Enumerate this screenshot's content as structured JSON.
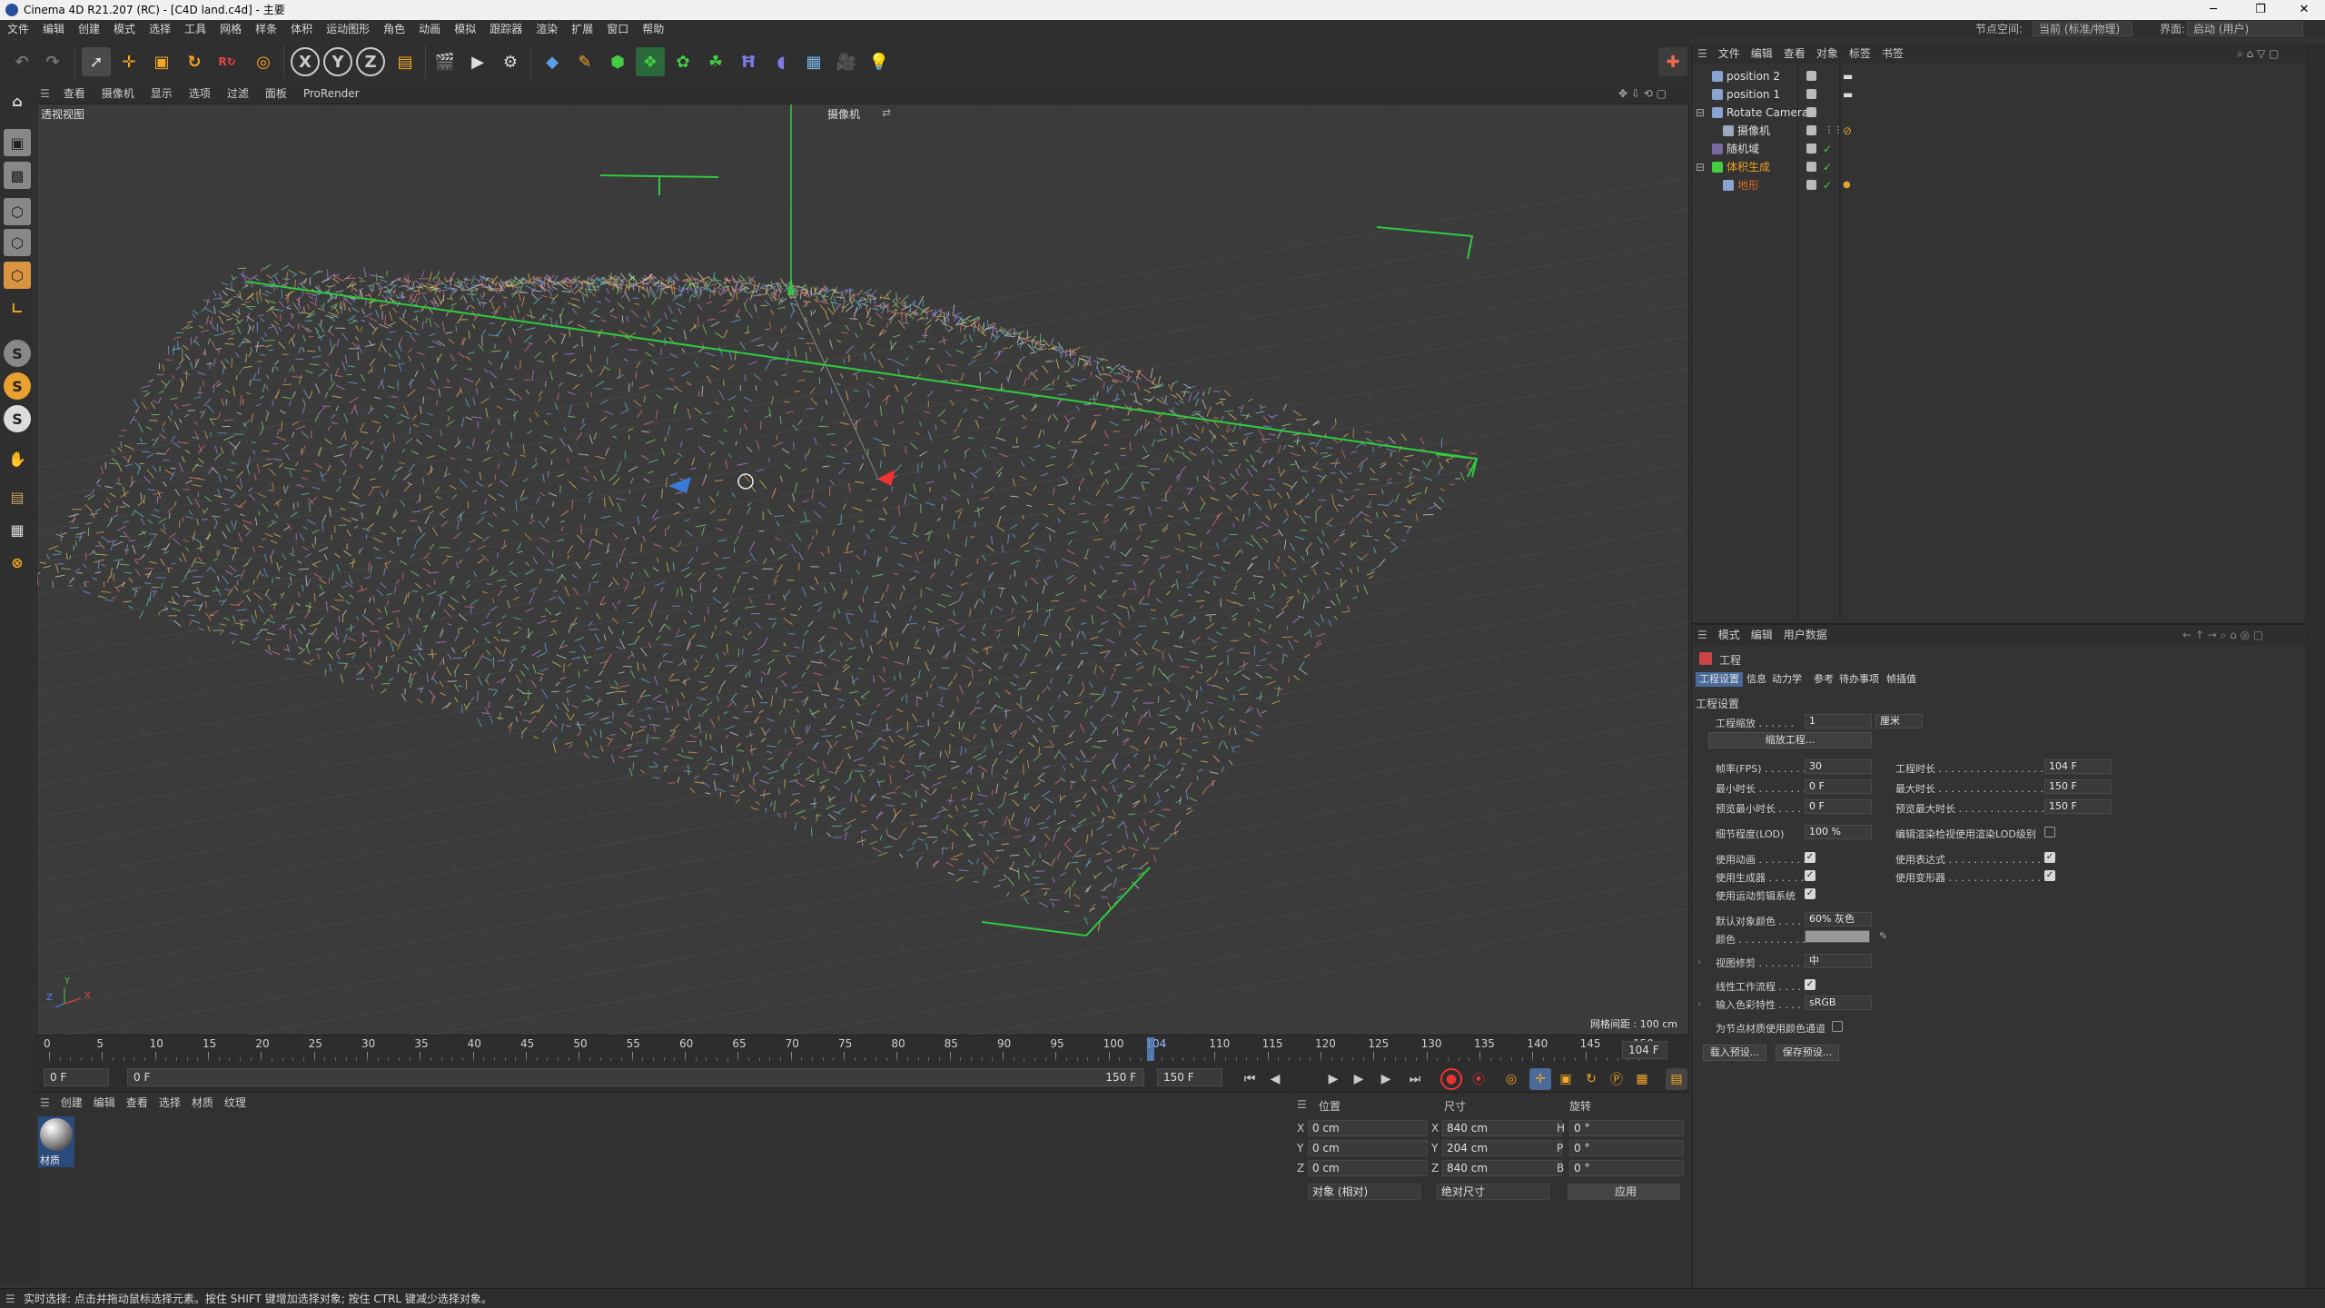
{
  "title": {
    "text": "Cinema 4D R21.207 (RC) - [C4D land.c4d] - 主要",
    "minimize": "─",
    "maximize": "❐",
    "close": "✕"
  },
  "menubar": {
    "items": [
      "文件",
      "编辑",
      "创建",
      "模式",
      "选择",
      "工具",
      "网格",
      "样条",
      "体积",
      "运动图形",
      "角色",
      "动画",
      "模拟",
      "跟踪器",
      "渲染",
      "扩展",
      "窗口",
      "帮助"
    ],
    "node_space_label": "节点空间:",
    "node_space_value": "当前 (标准/物理)",
    "layout_label": "界面:",
    "layout_value": "启动 (用户)"
  },
  "toolbar": {
    "x_label": "X",
    "y_label": "Y",
    "z_label": "Z"
  },
  "viewport": {
    "menu": [
      "查看",
      "摄像机",
      "显示",
      "选项",
      "过滤",
      "面板",
      "ProRender"
    ],
    "view_name": "透视视图",
    "camera_label": "摄像机",
    "grid_spacing": "网格间距 : 100 cm",
    "axis_x": "X",
    "axis_y": "Y",
    "axis_z": "Z"
  },
  "timeline": {
    "ticks": [
      "0",
      "5",
      "10",
      "15",
      "20",
      "25",
      "30",
      "35",
      "40",
      "45",
      "50",
      "55",
      "60",
      "65",
      "70",
      "75",
      "80",
      "85",
      "90",
      "95",
      "100",
      "104",
      "110",
      "115",
      "120",
      "125",
      "130",
      "135",
      "140",
      "145",
      "150"
    ],
    "current_frame": "104",
    "end_readout": "104 F",
    "start_field": "0 F",
    "range_start": "0 F",
    "range_end": "150 F",
    "end_field": "150 F",
    "playhead_fraction": 0.6933
  },
  "material_panel": {
    "menu": [
      "创建",
      "编辑",
      "查看",
      "选择",
      "材质",
      "纹理"
    ],
    "material_name": "材质"
  },
  "coord_panel": {
    "headers": [
      "位置",
      "尺寸",
      "旋转"
    ],
    "rows": [
      {
        "axis": "X",
        "pos": "0 cm",
        "size_axis": "X",
        "size": "840 cm",
        "rot_axis": "H",
        "rot": "0 °"
      },
      {
        "axis": "Y",
        "pos": "0 cm",
        "size_axis": "Y",
        "size": "204 cm",
        "rot_axis": "P",
        "rot": "0 °"
      },
      {
        "axis": "Z",
        "pos": "0 cm",
        "size_axis": "Z",
        "size": "840 cm",
        "rot_axis": "B",
        "rot": "0 °"
      }
    ],
    "mode_dropdown": "对象 (相对)",
    "size_dropdown": "绝对尺寸",
    "apply_button": "应用"
  },
  "status": "实时选择: 点击并拖动鼠标选择元素。按住 SHIFT 键增加选择对象; 按住 CTRL 键减少选择对象。",
  "object_manager": {
    "menu": [
      "文件",
      "编辑",
      "查看",
      "对象",
      "标签",
      "书签"
    ],
    "objects": [
      {
        "name": "position 2",
        "color": "#e0e0e0"
      },
      {
        "name": "position 1",
        "color": "#e0e0e0"
      },
      {
        "name": "Rotate Camera",
        "color": "#e0e0e0"
      },
      {
        "name": "摄像机",
        "color": "#e0e0e0"
      },
      {
        "name": "随机域",
        "color": "#e0e0e0"
      },
      {
        "name": "体积生成",
        "color": "#f0a020"
      },
      {
        "name": "地形",
        "color": "#d86a2a"
      }
    ]
  },
  "attribute_manager": {
    "menu": [
      "模式",
      "编辑",
      "用户数据"
    ],
    "object_title": "工程",
    "tabs": [
      "工程设置",
      "信息",
      "动力学",
      "参考",
      "待办事项",
      "帧插值"
    ],
    "section_title": "工程设置",
    "project_scale_label": "工程缩放 . . . . . .",
    "project_scale_value": "1",
    "project_scale_unit": "厘米",
    "scale_project_button": "缩放工程...",
    "fps_label": "帧率(FPS) . . . . . . .",
    "fps_value": "30",
    "project_duration_label": "工程时长 . . . . . . . . . . . . . . . . . .",
    "project_duration_value": "104 F",
    "min_time_label": "最小时长 . . . . . . . . .",
    "min_time_value": "0 F",
    "max_time_label": "最大时长 . . . . . . . . . . . . . . . . . .",
    "max_time_value": "150 F",
    "preview_min_label": "预览最小时长 . . . . .",
    "preview_min_value": "0 F",
    "preview_max_label": "预览最大时长 . . . . . . . . . . . . . . .",
    "preview_max_value": "150 F",
    "lod_label": "细节程度(LOD)",
    "lod_value": "100 %",
    "render_lod_label": "编辑渲染检视使用渲染LOD级别",
    "use_animation_label": "使用动画 . . . . . . . . .",
    "use_expressions_label": "使用表达式 . . . . . . . . . . . . . . . . .",
    "use_generators_label": "使用生成器 . . . . . . .",
    "use_deformers_label": "使用变形器 . . . . . . . . . . . . . . . . .",
    "use_motion_clip_label": "使用运动剪辑系统",
    "default_color_label": "默认对象颜色 . . . .",
    "default_color_value": "60% 灰色",
    "color_label": "颜色 . . . . . . . . . . . . . .",
    "view_clip_label": "视图修剪 . . . . . . . . .",
    "view_clip_value": "中",
    "linear_workflow_label": "线性工作流程 . . . . .",
    "input_color_label": "输入色彩特性 . . . . .",
    "input_color_value": "sRGB",
    "node_material_label": "为节点材质使用颜色通道",
    "load_preset_button": "载入预设...",
    "save_preset_button": "保存预设..."
  }
}
